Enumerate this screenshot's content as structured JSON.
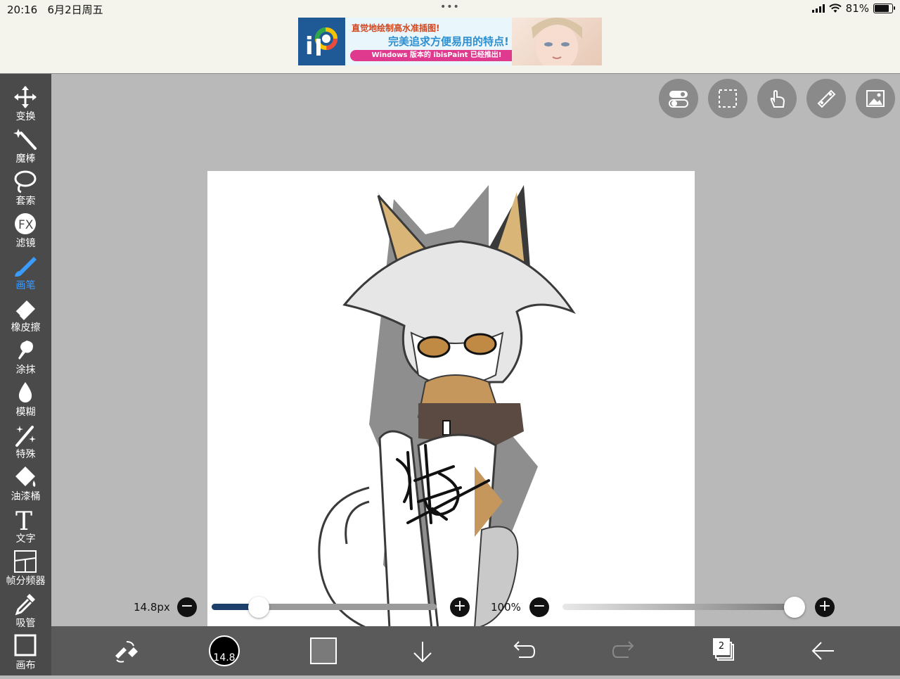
{
  "status_bar": {
    "time": "20:16",
    "date": "6月2日周五",
    "dots": "•••",
    "battery": "81%"
  },
  "ad": {
    "line1": "直觉地绘制高水准插图!",
    "line2": "完美追求方便易用的特点!",
    "line3": "Windows 版本的 ibisPaint 已经推出!"
  },
  "tools": [
    {
      "label": "变换",
      "icon": "move-icon"
    },
    {
      "label": "魔棒",
      "icon": "magic-wand-icon"
    },
    {
      "label": "套索",
      "icon": "lasso-icon"
    },
    {
      "label": "滤镜",
      "icon": "fx-icon"
    },
    {
      "label": "画笔",
      "icon": "brush-icon",
      "active": true
    },
    {
      "label": "橡皮擦",
      "icon": "eraser-icon"
    },
    {
      "label": "涂抹",
      "icon": "smudge-icon"
    },
    {
      "label": "模糊",
      "icon": "blur-drop-icon"
    },
    {
      "label": "特殊",
      "icon": "special-icon"
    },
    {
      "label": "油漆桶",
      "icon": "bucket-icon"
    },
    {
      "label": "文字",
      "icon": "text-icon"
    },
    {
      "label": "帧分频器",
      "icon": "frame-divider-icon"
    },
    {
      "label": "吸管",
      "icon": "eyedropper-icon"
    },
    {
      "label": "画布",
      "icon": "canvas-icon"
    }
  ],
  "brush": {
    "size_label": "14.8px",
    "size_value": "14.8",
    "size_fraction": 0.21,
    "opacity_label": "100%",
    "opacity_fraction": 1.0,
    "minus": "−",
    "plus": "+"
  },
  "layers": {
    "count": "2"
  },
  "colors": {
    "accent": "#3b9cff",
    "toolbar": "#4a4a4a",
    "slider_fill": "#1c3f6b"
  }
}
